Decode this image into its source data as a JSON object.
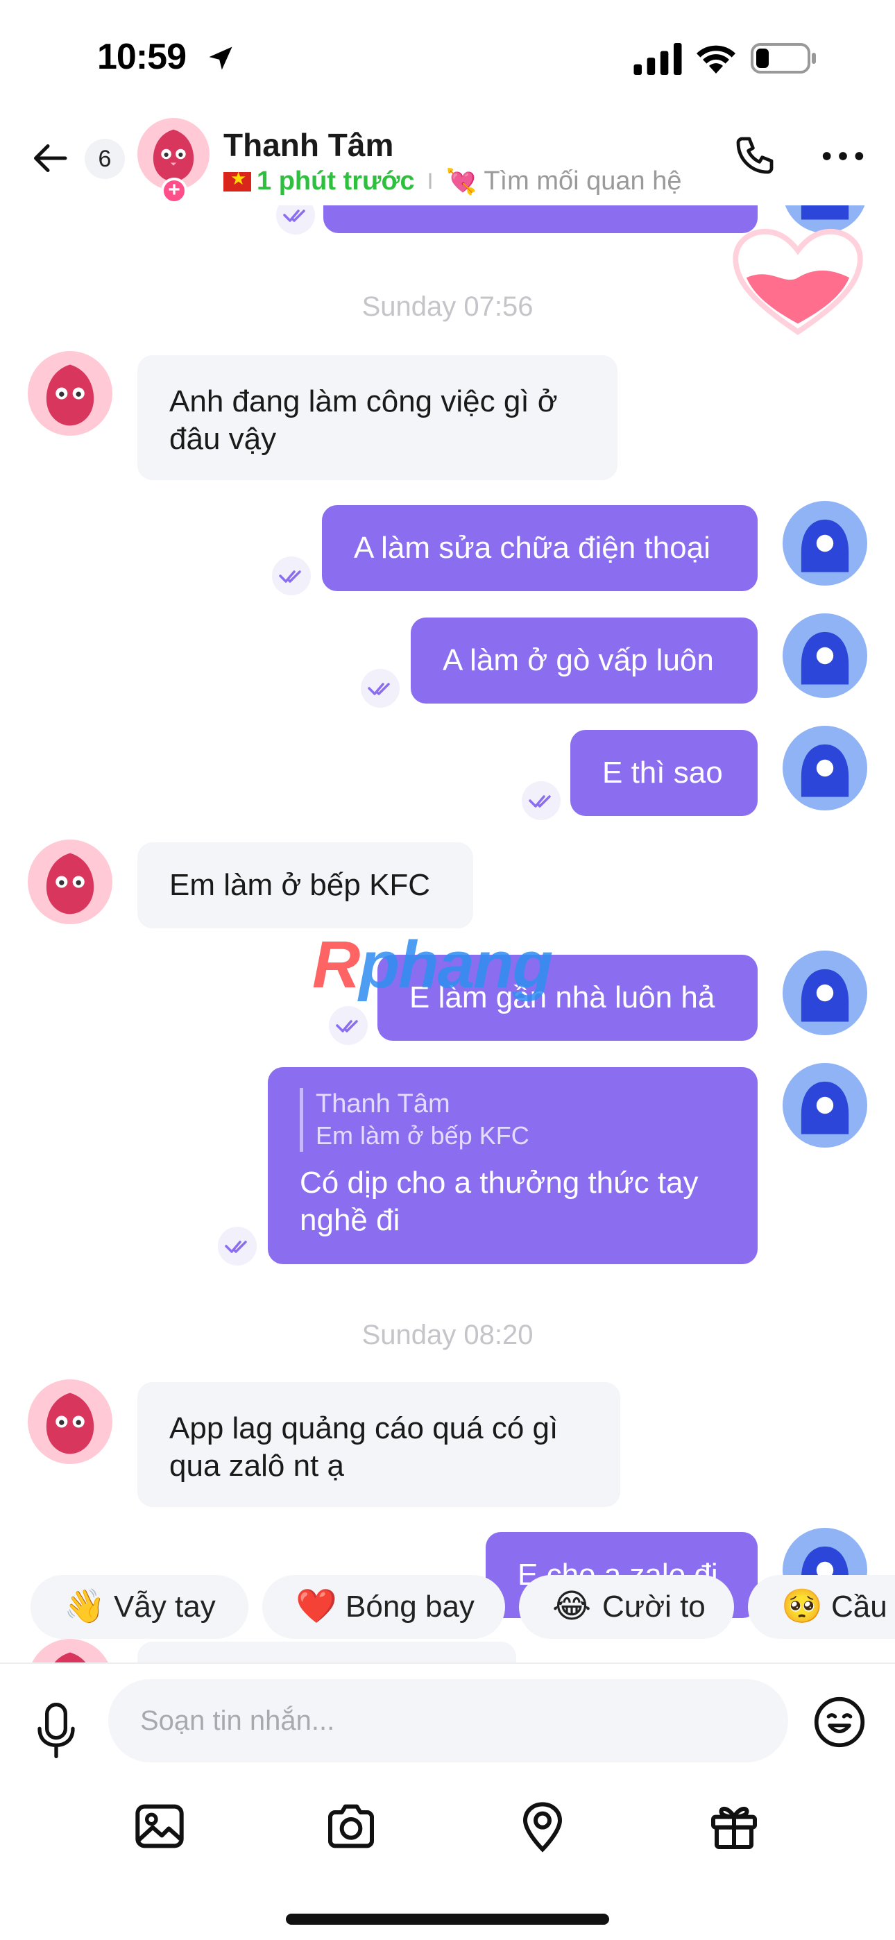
{
  "status_bar": {
    "time": "10:59"
  },
  "header": {
    "unread_count": "6",
    "contact_name": "Thanh Tâm",
    "online_status": "1 phút trước",
    "separator": "I",
    "relationship": "Tìm mối quan hệ"
  },
  "messages": {
    "date_1": "Sunday 07:56",
    "in_1": "Anh đang làm công việc gì ở đâu vậy",
    "out_1": "A làm sửa chữa điện thoại",
    "out_2": "A làm ở gò vấp luôn",
    "out_3": "E thì sao",
    "in_2": "Em làm ở  bếp KFC",
    "out_4": "E làm gần nhà luôn hả",
    "reply_name": "Thanh Tâm",
    "reply_text": "Em làm ở  bếp KFC",
    "out_5": "Có dịp cho a thưởng thức tay nghề đi",
    "date_2": "Sunday 08:20",
    "in_3": "App lag quảng cáo quá có gì qua zalô nt ạ",
    "out_6": "E cho a zalo đi"
  },
  "watermark": {
    "r": "R",
    "rest": "phang"
  },
  "reactions": [
    {
      "emoji": "👋",
      "label": "Vẫy tay"
    },
    {
      "emoji": "❤️",
      "label": "Bóng bay"
    },
    {
      "emoji": "😂",
      "label": "Cười to"
    },
    {
      "emoji": "🥺",
      "label": "Cầu"
    }
  ],
  "composer": {
    "placeholder": "Soạn tin nhắn..."
  },
  "colors": {
    "outgoing": "#8b6ef0",
    "incoming": "#f4f5f8",
    "online": "#2fbf3f"
  }
}
